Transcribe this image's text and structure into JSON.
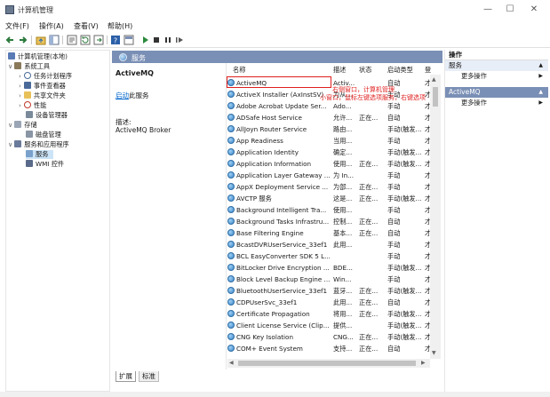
{
  "window": {
    "title": "计算机管理",
    "minimize": "—",
    "maximize": "☐",
    "close": "✕"
  },
  "menu": [
    "文件(F)",
    "操作(A)",
    "查看(V)",
    "帮助(H)"
  ],
  "tree": [
    {
      "label": "计算机管理(本地)",
      "level": 0,
      "icon": "computer-icon"
    },
    {
      "label": "系统工具",
      "level": 1,
      "icon": "tools-icon",
      "expander": "∨"
    },
    {
      "label": "任务计划程序",
      "level": 2,
      "icon": "clock-icon",
      "expander": "›"
    },
    {
      "label": "事件查看器",
      "level": 2,
      "icon": "event-icon",
      "expander": "›"
    },
    {
      "label": "共享文件夹",
      "level": 2,
      "icon": "folder-icon",
      "expander": "›"
    },
    {
      "label": "性能",
      "level": 2,
      "icon": "performance-icon",
      "expander": "›"
    },
    {
      "label": "设备管理器",
      "level": 2,
      "icon": "device-icon"
    },
    {
      "label": "存储",
      "level": 1,
      "icon": "storage-icon",
      "expander": "∨"
    },
    {
      "label": "磁盘管理",
      "level": 2,
      "icon": "disk-icon"
    },
    {
      "label": "服务和应用程序",
      "level": 1,
      "icon": "services-apps-icon",
      "expander": "∨"
    },
    {
      "label": "服务",
      "level": 2,
      "icon": "services-icon",
      "selected": true
    },
    {
      "label": "WMI 控件",
      "level": 2,
      "icon": "wmi-icon"
    }
  ],
  "middle": {
    "header": "服务",
    "selected_service": "ActiveMQ",
    "action_link": "启动",
    "action_suffix": "此服务",
    "description_label": "描述:",
    "description": "ActiveMQ Broker"
  },
  "columns": {
    "name": "名称",
    "description": "描述",
    "status": "状态",
    "startup": "启动类型",
    "logon": "登"
  },
  "services": [
    {
      "name": "ActiveMQ",
      "desc": "Activ...",
      "status": "",
      "startup": "自动",
      "logon": "才"
    },
    {
      "name": "ActiveX Installer (AxInstSV)",
      "desc": "为从...",
      "status": "",
      "startup": "手动",
      "logon": "才"
    },
    {
      "name": "Adobe Acrobat Update Ser...",
      "desc": "Ado...",
      "status": "",
      "startup": "手动",
      "logon": "才"
    },
    {
      "name": "ADSafe Host Service",
      "desc": "允许...",
      "status": "正在...",
      "startup": "自动",
      "logon": "才"
    },
    {
      "name": "AllJoyn Router Service",
      "desc": "路由...",
      "status": "",
      "startup": "手动(触发...",
      "logon": "才"
    },
    {
      "name": "App Readiness",
      "desc": "当用...",
      "status": "",
      "startup": "手动",
      "logon": "才"
    },
    {
      "name": "Application Identity",
      "desc": "确定...",
      "status": "",
      "startup": "手动(触发...",
      "logon": "才"
    },
    {
      "name": "Application Information",
      "desc": "使用...",
      "status": "正在...",
      "startup": "手动(触发...",
      "logon": "才"
    },
    {
      "name": "Application Layer Gateway ...",
      "desc": "为 In...",
      "status": "",
      "startup": "手动",
      "logon": "才"
    },
    {
      "name": "AppX Deployment Service ...",
      "desc": "为部...",
      "status": "正在...",
      "startup": "手动",
      "logon": "才"
    },
    {
      "name": "AVCTP 服务",
      "desc": "这是...",
      "status": "正在...",
      "startup": "手动(触发...",
      "logon": "才"
    },
    {
      "name": "Background Intelligent Tra...",
      "desc": "使用...",
      "status": "",
      "startup": "手动",
      "logon": "才"
    },
    {
      "name": "Background Tasks Infrastru...",
      "desc": "控制...",
      "status": "正在...",
      "startup": "自动",
      "logon": "才"
    },
    {
      "name": "Base Filtering Engine",
      "desc": "基本...",
      "status": "正在...",
      "startup": "自动",
      "logon": "才"
    },
    {
      "name": "BcastDVRUserService_33ef1",
      "desc": "此用...",
      "status": "",
      "startup": "手动",
      "logon": "才"
    },
    {
      "name": "BCL EasyConverter SDK 5 L...",
      "desc": "",
      "status": "",
      "startup": "手动",
      "logon": "才"
    },
    {
      "name": "BitLocker Drive Encryption ...",
      "desc": "BDE...",
      "status": "",
      "startup": "手动(触发...",
      "logon": "才"
    },
    {
      "name": "Block Level Backup Engine ...",
      "desc": "Win...",
      "status": "",
      "startup": "手动",
      "logon": "才"
    },
    {
      "name": "BluetoothUserService_33ef1",
      "desc": "蓝牙...",
      "status": "正在...",
      "startup": "手动(触发...",
      "logon": "才"
    },
    {
      "name": "CDPUserSvc_33ef1",
      "desc": "此用...",
      "status": "正在...",
      "startup": "自动",
      "logon": "才"
    },
    {
      "name": "Certificate Propagation",
      "desc": "将用...",
      "status": "正在...",
      "startup": "手动(触发...",
      "logon": "才"
    },
    {
      "name": "Client License Service (Clip...",
      "desc": "提供...",
      "status": "",
      "startup": "手动(触发...",
      "logon": "才"
    },
    {
      "name": "CNG Key Isolation",
      "desc": "CNG...",
      "status": "正在...",
      "startup": "手动(触发...",
      "logon": "才"
    },
    {
      "name": "COM+ Event System",
      "desc": "支持...",
      "status": "正在...",
      "startup": "自动",
      "logon": "才"
    }
  ],
  "annotation": {
    "line1": "右侧窗口，计算机管理",
    "line2": "小窗口，鼠标左键选项服务，右键选项"
  },
  "actions": {
    "title": "操作",
    "sections": [
      {
        "header": "服务",
        "item": "更多操作"
      },
      {
        "header": "ActiveMQ",
        "item": "更多操作"
      }
    ]
  },
  "tabs": [
    "扩展",
    "标准"
  ],
  "colors": {
    "header_blue": "#7a8fb5",
    "selection": "#cce4f7",
    "annotation_red": "#e01e1e",
    "link_blue": "#0066cc"
  }
}
